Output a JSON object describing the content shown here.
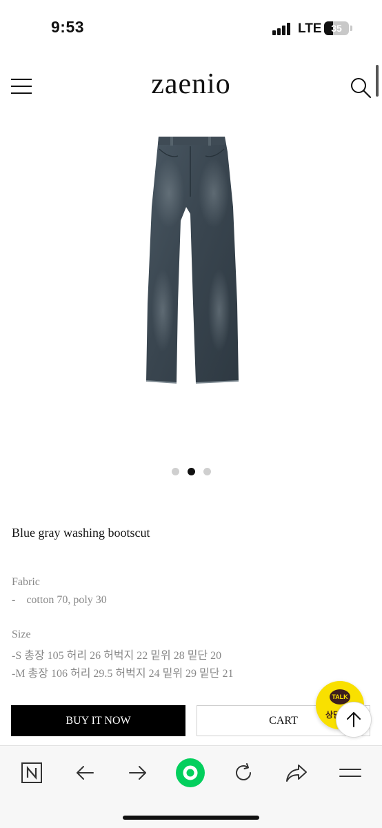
{
  "status_bar": {
    "time": "9:53",
    "network": "LTE",
    "battery_level": "35",
    "battery_percent": 35
  },
  "header": {
    "logo": "zaenio",
    "menu_icon": "hamburger-menu-icon",
    "search_icon": "search-icon"
  },
  "product_image": {
    "icon": "jeans-product-photo",
    "carousel": {
      "total": 3,
      "active_index": 1
    }
  },
  "product": {
    "title": "Blue gray washing bootscut",
    "fabric": {
      "label": "Fabric",
      "line": "-    cotton 70, poly 30"
    },
    "size": {
      "label": "Size",
      "lines": [
        "-S 총장 105 허리 26 허벅지 22 밑위 28 밑단 20",
        "-M 총장 106 허리 29.5 허벅지 24 밑위 29 밑단 21"
      ]
    }
  },
  "actions": {
    "buy_now": "BUY IT NOW",
    "cart": "CART"
  },
  "kakao": {
    "bubble": "TALK",
    "text": "상담"
  },
  "browser_toolbar": {
    "items": [
      "naver-n-icon",
      "back-arrow-icon",
      "forward-arrow-icon",
      "green-home-icon",
      "reload-icon",
      "share-icon",
      "menu-lines-icon"
    ],
    "accent": "#03cf5d"
  }
}
